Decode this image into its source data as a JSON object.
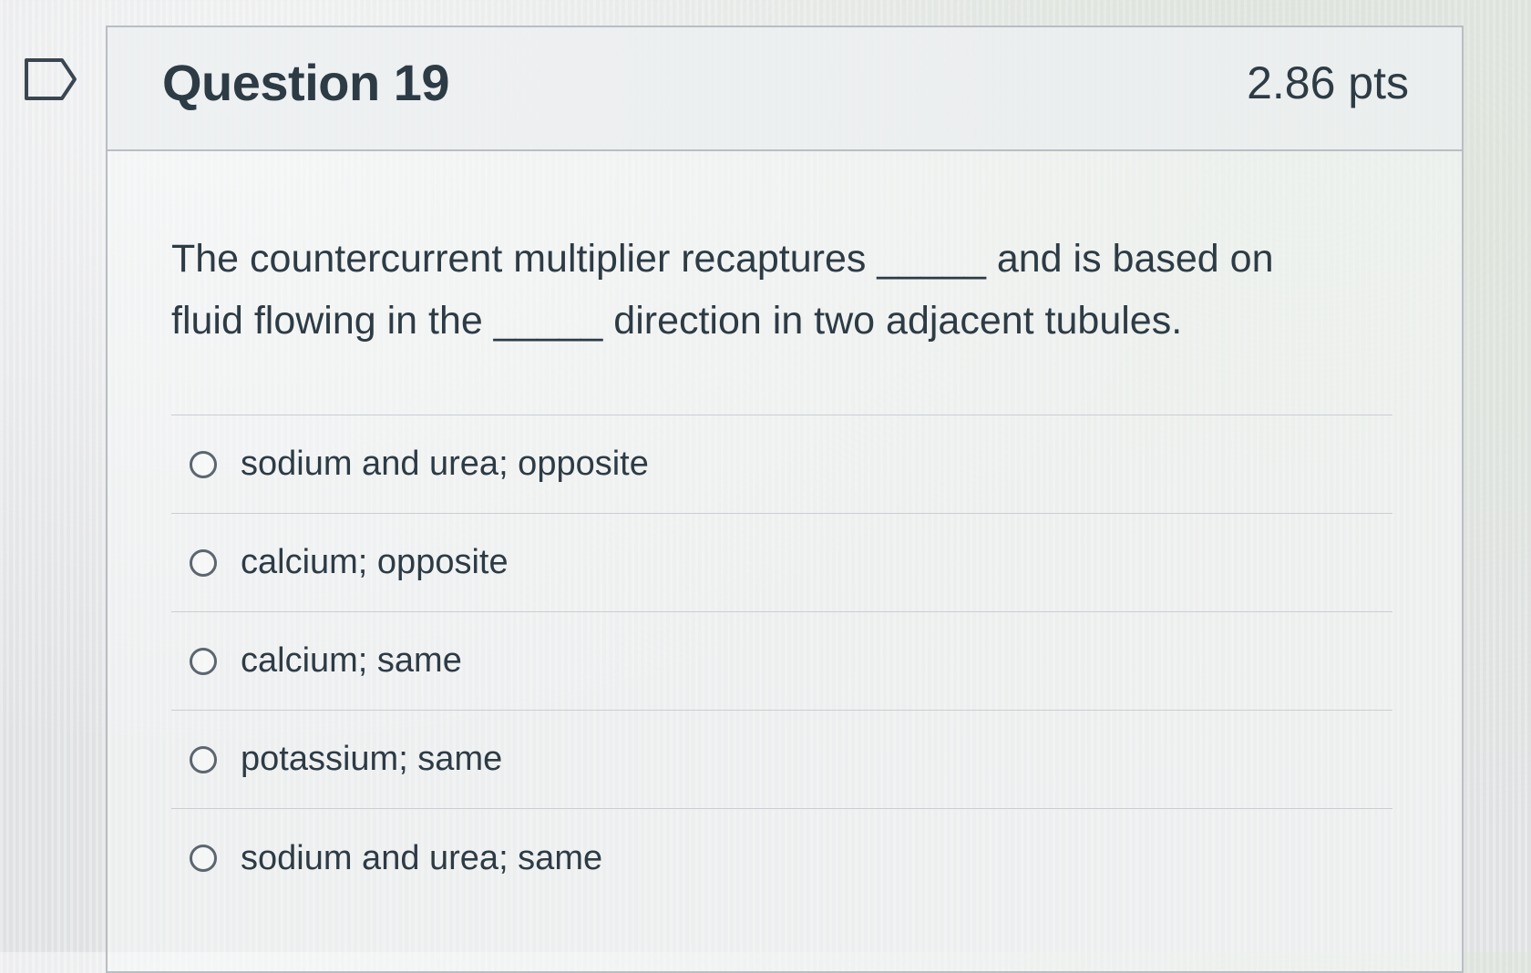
{
  "question": {
    "title": "Question 19",
    "points": "2.86 pts",
    "text": "The countercurrent multiplier recaptures _____ and is based on fluid flowing in the _____ direction in two adjacent tubules."
  },
  "answers": [
    {
      "label": "sodium and urea; opposite"
    },
    {
      "label": "calcium; opposite"
    },
    {
      "label": "calcium; same"
    },
    {
      "label": "potassium; same"
    },
    {
      "label": "sodium and urea; same"
    }
  ]
}
